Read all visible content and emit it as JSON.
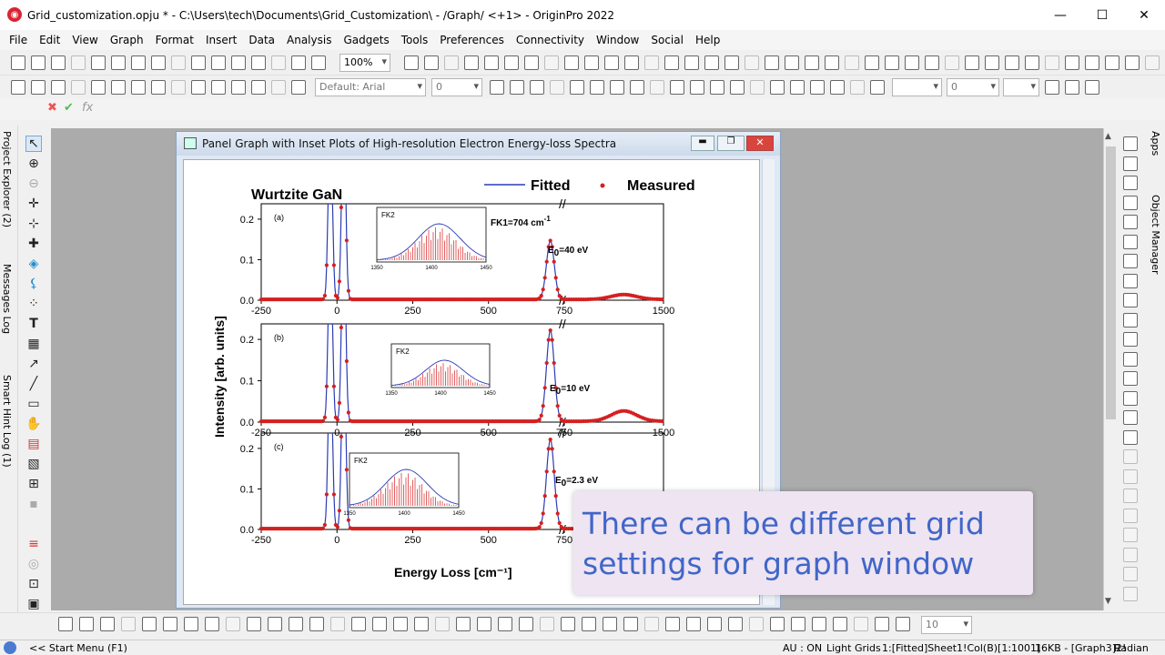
{
  "window": {
    "title": "Grid_customization.opju * - C:\\Users\\tech\\Documents\\Grid_Customization\\ - /Graph/ <+1> - OriginPro 2022",
    "minimize": "—",
    "maximize": "☐",
    "close": "✕"
  },
  "menu": [
    "File",
    "Edit",
    "View",
    "Graph",
    "Format",
    "Insert",
    "Data",
    "Analysis",
    "Gadgets",
    "Tools",
    "Preferences",
    "Connectivity",
    "Window",
    "Social",
    "Help"
  ],
  "toolbar": {
    "zoom": "100%",
    "font": "Default: Arial",
    "font_size": "0",
    "line_width": "0",
    "bottom_value": "10"
  },
  "formula_bar": {
    "x": "✖",
    "check": "✔",
    "fx": "fx"
  },
  "left_dock": [
    "Project Explorer (2)",
    "Messages Log",
    "Smart Hint Log (1)"
  ],
  "right_dock": [
    "Apps",
    "Object Manager"
  ],
  "graph_window": {
    "title": "Panel Graph with Inset Plots of High-resolution Electron Energy-loss Spectra"
  },
  "chart_data": {
    "type": "line",
    "title": "Wurtzite GaN",
    "legend": [
      "Fitted",
      "Measured"
    ],
    "legend_placement": "top-right",
    "xlabel": "Energy Loss [cm⁻¹]",
    "ylabel": "Intensity [arb. units]",
    "xlim": [
      -250,
      1500
    ],
    "ylim": [
      0,
      0.22
    ],
    "xticks": [
      "-250",
      "0",
      "250",
      "500",
      "750",
      "1500"
    ],
    "yticks": [
      "0.0",
      "0.1",
      "0.2"
    ],
    "panels": [
      {
        "label": "(a)",
        "energy": "E",
        "energy_sub": "0",
        "energy_val": "=40 eV",
        "annotation": "FK1=704 cm",
        "annotation_sup": "-1",
        "inset": {
          "label": "FK2",
          "xticks": [
            "1350",
            "1400",
            "1450"
          ]
        }
      },
      {
        "label": "(b)",
        "energy": "E",
        "energy_sub": "0",
        "energy_val": "=10 eV",
        "inset": {
          "label": "FK2",
          "xticks": [
            "1350",
            "1400",
            "1450"
          ]
        }
      },
      {
        "label": "(c)",
        "energy": "E",
        "energy_sub": "0",
        "energy_val": "=2.3 eV",
        "inset": {
          "label": "FK2",
          "xticks": [
            "1350",
            "1400",
            "1450"
          ]
        }
      }
    ],
    "series": [
      {
        "name": "Fitted",
        "color": "#2b3bb5"
      },
      {
        "name": "Measured",
        "color": "#d42020"
      }
    ]
  },
  "status": {
    "start_menu": "<< Start Menu (F1)",
    "au": "AU : ON",
    "grids": "Light Grids",
    "cell": "1:[Fitted]Sheet1!Col(B)[1:1001]",
    "mem": "16KB - [Graph3]2!",
    "angle": "Radian"
  },
  "caption": {
    "line1": "There can be different grid",
    "line2": "settings for graph window"
  },
  "colors": {
    "accent": "#4166c8",
    "caption_bg": "#eee4f2",
    "workspace": "#ababab"
  }
}
